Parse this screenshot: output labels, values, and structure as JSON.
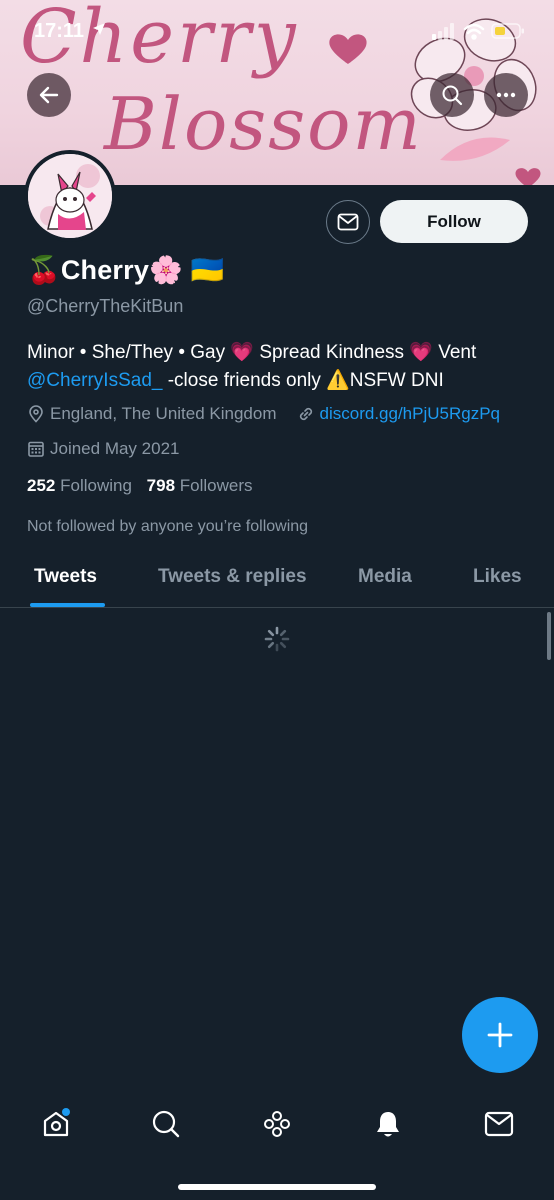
{
  "status_bar": {
    "time": "17:11"
  },
  "banner": {
    "line1": "Cherry",
    "line2": "Blossom"
  },
  "profile": {
    "display_name": "🍒Cherry🌸 🇺🇦",
    "handle": "@CherryTheKitBun",
    "bio_part1": "Minor • She/They • Gay 💗 Spread Kindness 💗 Vent ",
    "bio_mention": "@CherryIsSad_",
    "bio_part2": " -close friends only ⚠️NSFW DNI",
    "location": "England, The United Kingdom",
    "website": "discord.gg/hPjU5RgzPq",
    "joined": "Joined May 2021",
    "following_count": "252",
    "following_label": "Following",
    "followers_count": "798",
    "followers_label": "Followers",
    "not_followed_text": "Not followed by anyone you’re following",
    "follow_label": "Follow"
  },
  "tabs": [
    {
      "label": "Tweets",
      "active": true
    },
    {
      "label": "Tweets & replies",
      "active": false
    },
    {
      "label": "Media",
      "active": false
    },
    {
      "label": "Likes",
      "active": false
    }
  ],
  "icons": {
    "back": "arrow-left-icon",
    "search": "search-icon",
    "more": "more-horizontal-icon",
    "message": "envelope-icon",
    "compose": "plus-icon",
    "nav": [
      "home-icon",
      "search-icon",
      "spaces-icon",
      "bell-icon",
      "mail-icon"
    ]
  },
  "colors": {
    "background": "#15202b",
    "accent": "#1d9bf0",
    "muted": "#8b98a5",
    "banner_pink": "#f0d4df",
    "banner_ink": "#c2567f"
  }
}
